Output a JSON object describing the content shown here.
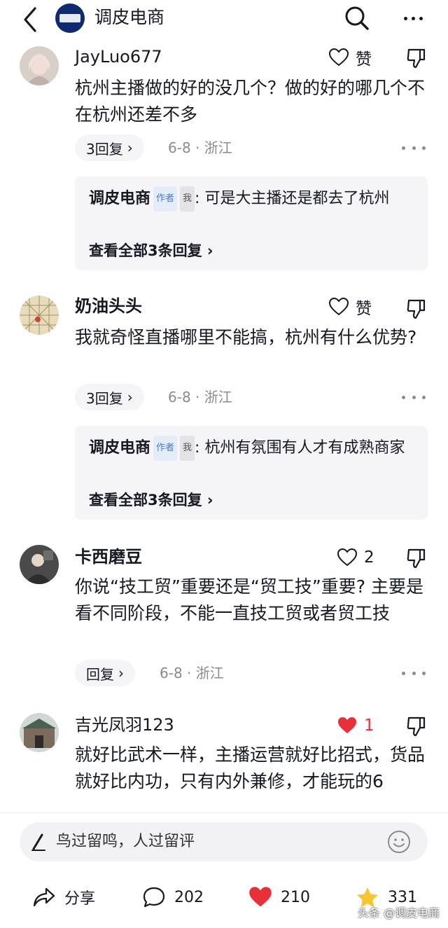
{
  "header": {
    "title": "调皮电商"
  },
  "comments": [
    {
      "username": "JayLuo677",
      "content": "杭州主播做的好的没几个？做的好的哪几个不在杭州还差不多",
      "like_label": "赞",
      "reply_count": "3回复",
      "date_location": "6-8 · 浙江",
      "reply": {
        "author": "调皮电商",
        "author_tag": "作者",
        "me_tag": "我",
        "text": ": 可是大主播还是都去了杭州",
        "view_all": "查看全部3条回复"
      }
    },
    {
      "username": "奶油头头",
      "content": "我就奇怪直播哪里不能搞，杭州有什么优势?",
      "like_label": "赞",
      "reply_count": "3回复",
      "date_location": "6-8 · 浙江",
      "reply": {
        "author": "调皮电商",
        "author_tag": "作者",
        "me_tag": "我",
        "text": ": 杭州有氛围有人才有成熟商家",
        "view_all": "查看全部3条回复"
      }
    },
    {
      "username": "卡西磨豆",
      "content": "你说“技工贸”重要还是“贸工技”重要? 主要是看不同阶段，不能一直技工贸或者贸工技",
      "like_label": "2",
      "reply_count": "回复",
      "date_location": "6-8 · 浙江"
    },
    {
      "username": "吉光凤羽123",
      "content": "就好比武术一样，主播运营就好比招式，货品就好比内功，只有内外兼修，才能玩的6",
      "like_label": "1"
    }
  ],
  "input": {
    "placeholder": "鸟过留鸣，人过留评"
  },
  "bottom_bar": {
    "share": "分享",
    "comments": "202",
    "likes": "210",
    "favorites": "331"
  },
  "watermark": "头条 @调皮电商",
  "colors": {
    "liked_heart": "#e8303a",
    "favorite_star": "#f7c531",
    "author_tag": "#4a78c2"
  }
}
